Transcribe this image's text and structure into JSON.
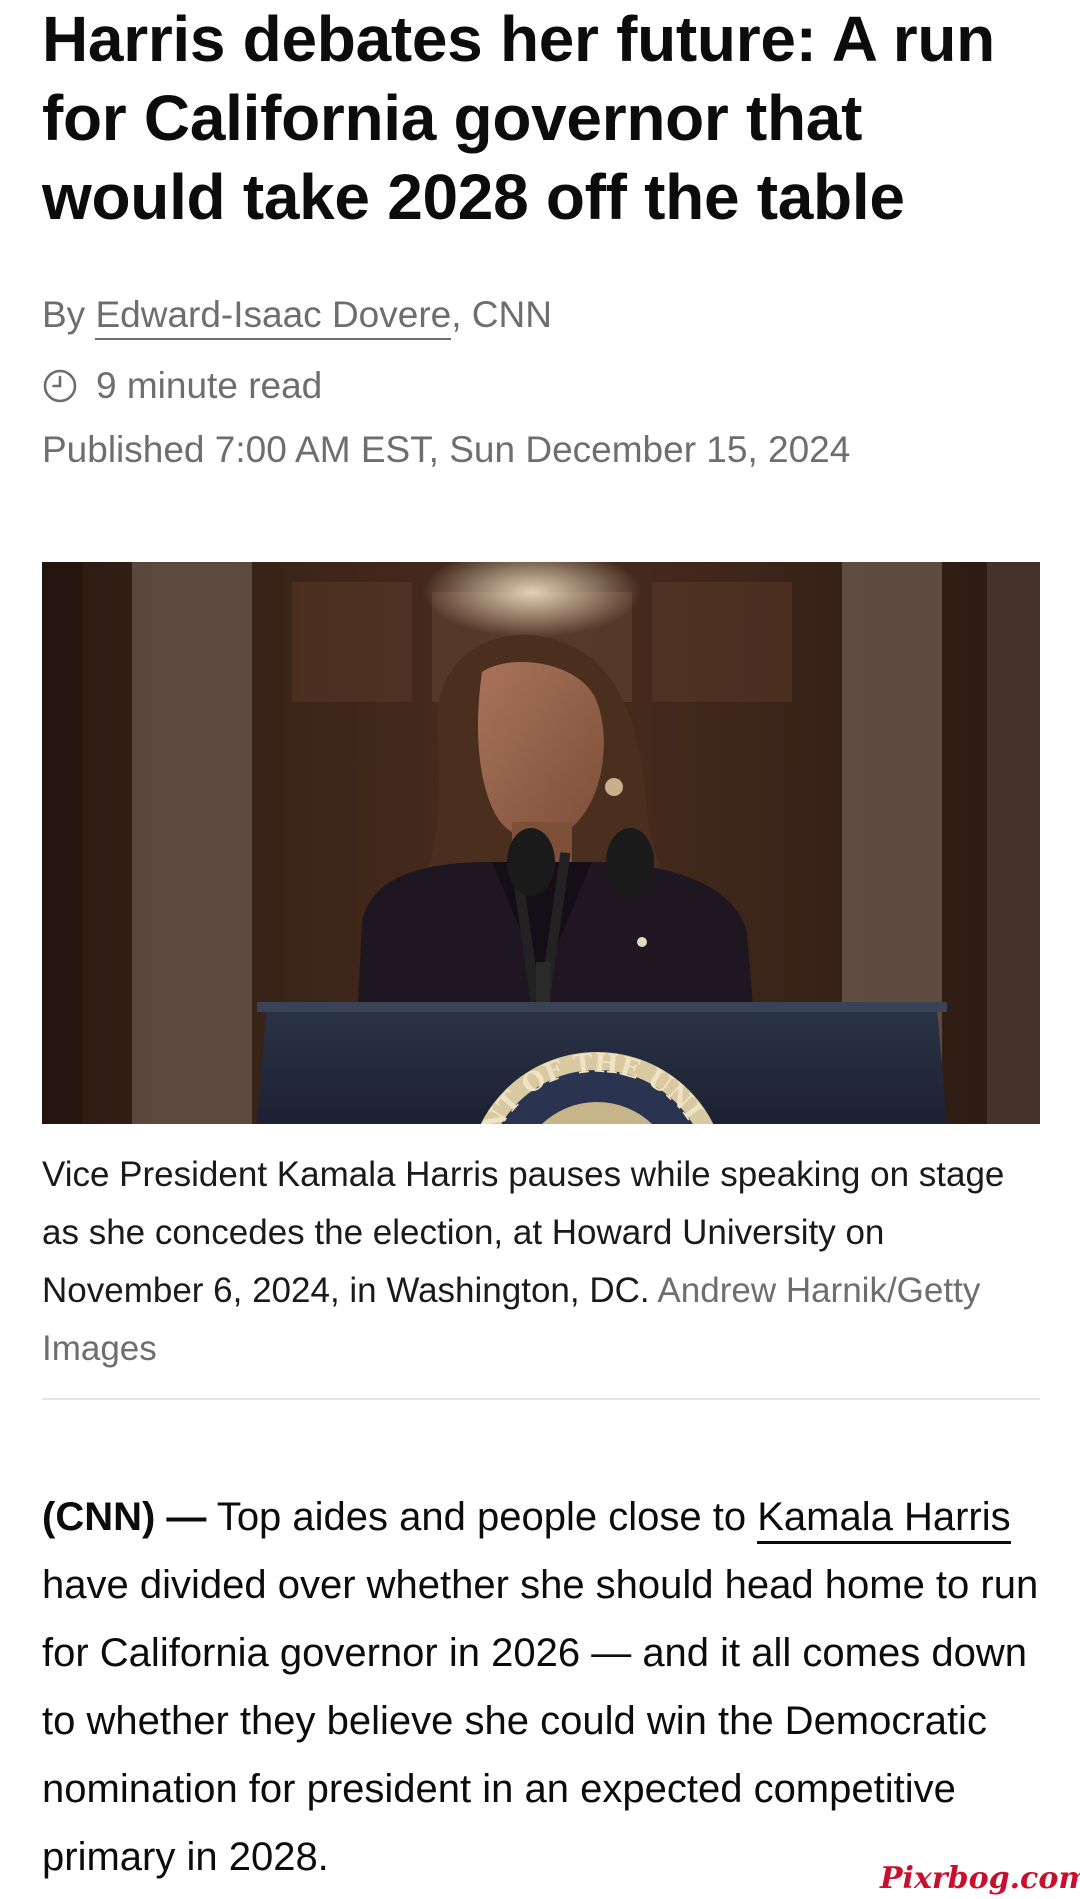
{
  "article": {
    "headline": "Harris debates her future: A run for California governor that would take 2028 off the table",
    "byline": {
      "prefix": "By ",
      "author": "Edward-Isaac Dovere",
      "suffix": ", CNN"
    },
    "read_time": "9 minute read",
    "published": "Published 7:00 AM EST, Sun December 15, 2024",
    "image": {
      "podium_seal_text": "ENT OF THE UNI"
    },
    "caption": {
      "text": "Vice President Kamala Harris pauses while speaking on stage as she concedes the election, at Howard University on November 6, 2024, in Washington, DC.",
      "credit": "Andrew Harnik/Getty Images"
    },
    "body": {
      "dateline": "(CNN) —",
      "link_text": "Kamala Harris",
      "paragraph_rest": "have divided over whether she should head home to run for California governor in 2026 — and it all comes down to whether they believe she could win the Democratic nomination for president in an expected competitive primary in 2028.",
      "paragraph_start": "Top aides and people close to"
    }
  },
  "watermark": "Pixrbog.com",
  "icons": {
    "read_time": "clock-icon"
  },
  "colors": {
    "text": "#0c0c0c",
    "muted": "#6e6e6e",
    "watermark": "#c8102e"
  }
}
